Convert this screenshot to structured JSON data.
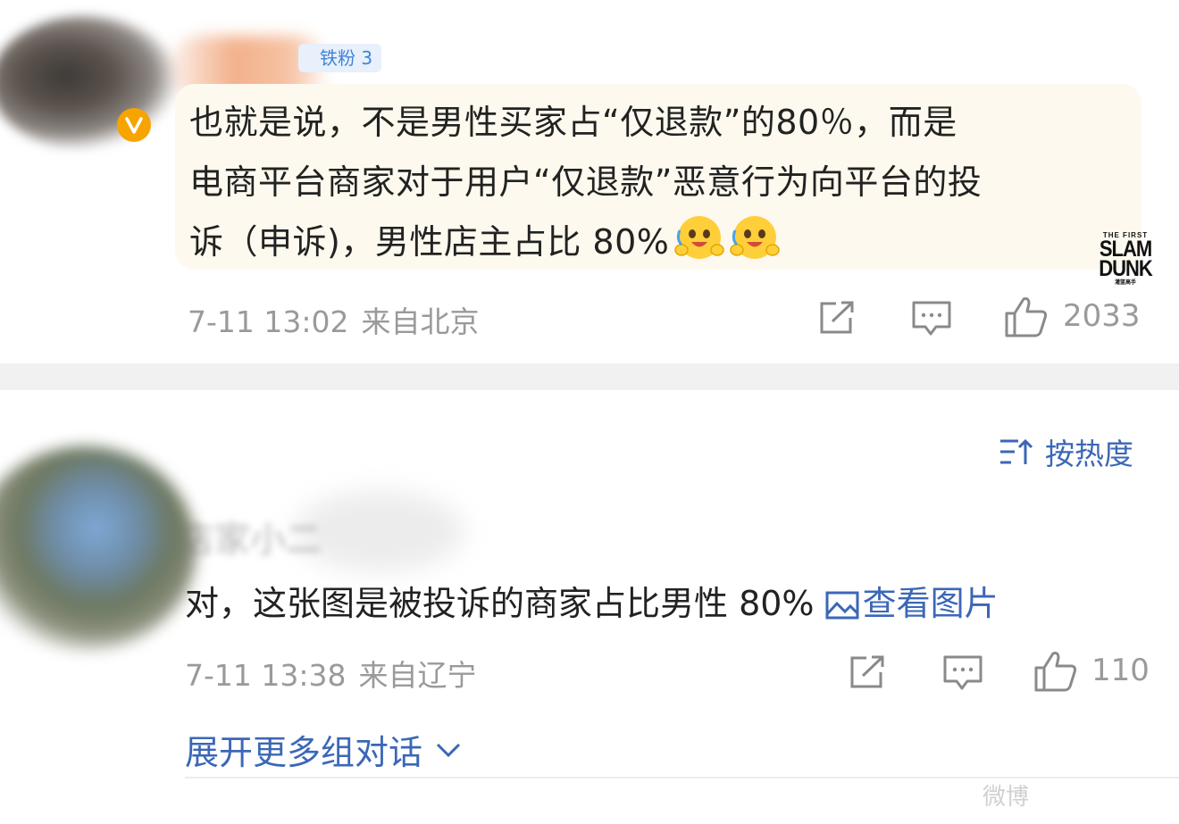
{
  "comment1": {
    "badge": "铁粉 3",
    "text_line1": "也就是说，不是男性买家占“仅退款”的80％，而是",
    "text_line2": "电商平台商家对于用户“仅退款”恶意行为向平台的投",
    "text_line3": "诉（申诉)，男性店主占比 80%",
    "date": "7-11 13:02",
    "location": "来自北京",
    "likes": "2033",
    "emoji_icon": "hug-emoji-icon",
    "logo": {
      "top": "THE FIRST",
      "line1": "SLAM",
      "line2": "DUNK",
      "bottom": "灌篮高手"
    }
  },
  "sort": {
    "label": "按热度",
    "icon": "sort-icon"
  },
  "comment2": {
    "name_blurred": "店家小二",
    "text": "对，这张图是被投诉的商家占比男性 80%",
    "image_link": "查看图片",
    "date": "7-11 13:38",
    "location": "来自辽宁",
    "likes": "110"
  },
  "expand": {
    "label": "展开更多组对话"
  },
  "watermark": "微博",
  "colors": {
    "link": "#3b67b7",
    "meta": "#9a9a9a",
    "bubble": "#fdf9ee",
    "badge_bg": "#e7f0fb",
    "badge_text": "#3f83d8",
    "vip": "#f7a300"
  }
}
